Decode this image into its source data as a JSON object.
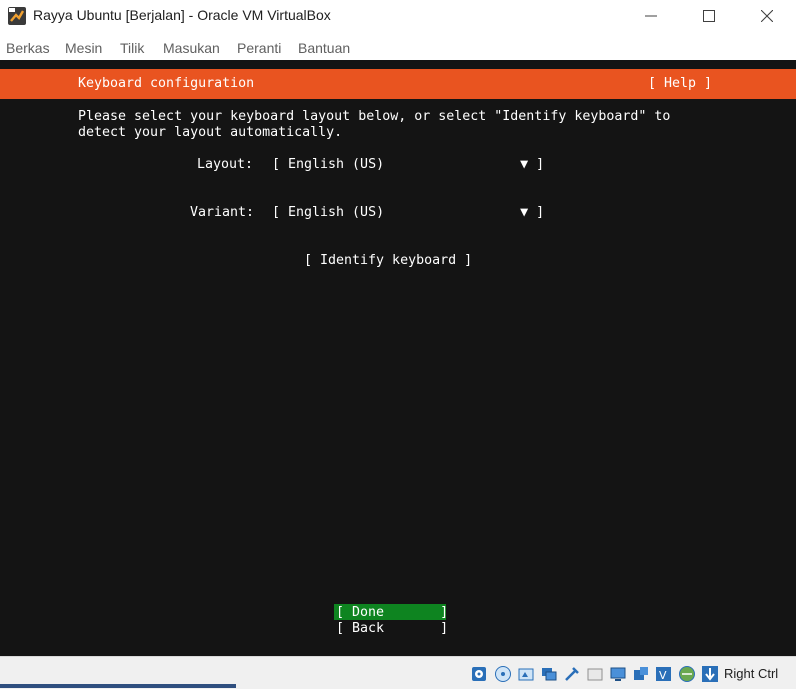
{
  "window": {
    "title": "Rayya Ubuntu [Berjalan] - Oracle VM VirtualBox"
  },
  "menubar": {
    "items": [
      "Berkas",
      "Mesin",
      "Tilik",
      "Masukan",
      "Peranti",
      "Bantuan"
    ]
  },
  "installer": {
    "header_title": "Keyboard configuration",
    "help_label": "[ Help ]",
    "instruction_line1": "Please select your keyboard layout below, or select \"Identify keyboard\" to",
    "instruction_line2": "detect your layout automatically.",
    "layout": {
      "label": "Layout:",
      "value": "[ English (US)                 ▼ ]"
    },
    "variant": {
      "label": "Variant:",
      "value": "[ English (US)                 ▼ ]"
    },
    "identify_label": "[ Identify keyboard ]",
    "done_label": "[ Done       ]",
    "back_label": "[ Back       ]"
  },
  "statusbar": {
    "host_key": "Right Ctrl"
  },
  "colors": {
    "accent": "#e95420",
    "done": "#0e8420",
    "screen_bg": "#141414"
  }
}
